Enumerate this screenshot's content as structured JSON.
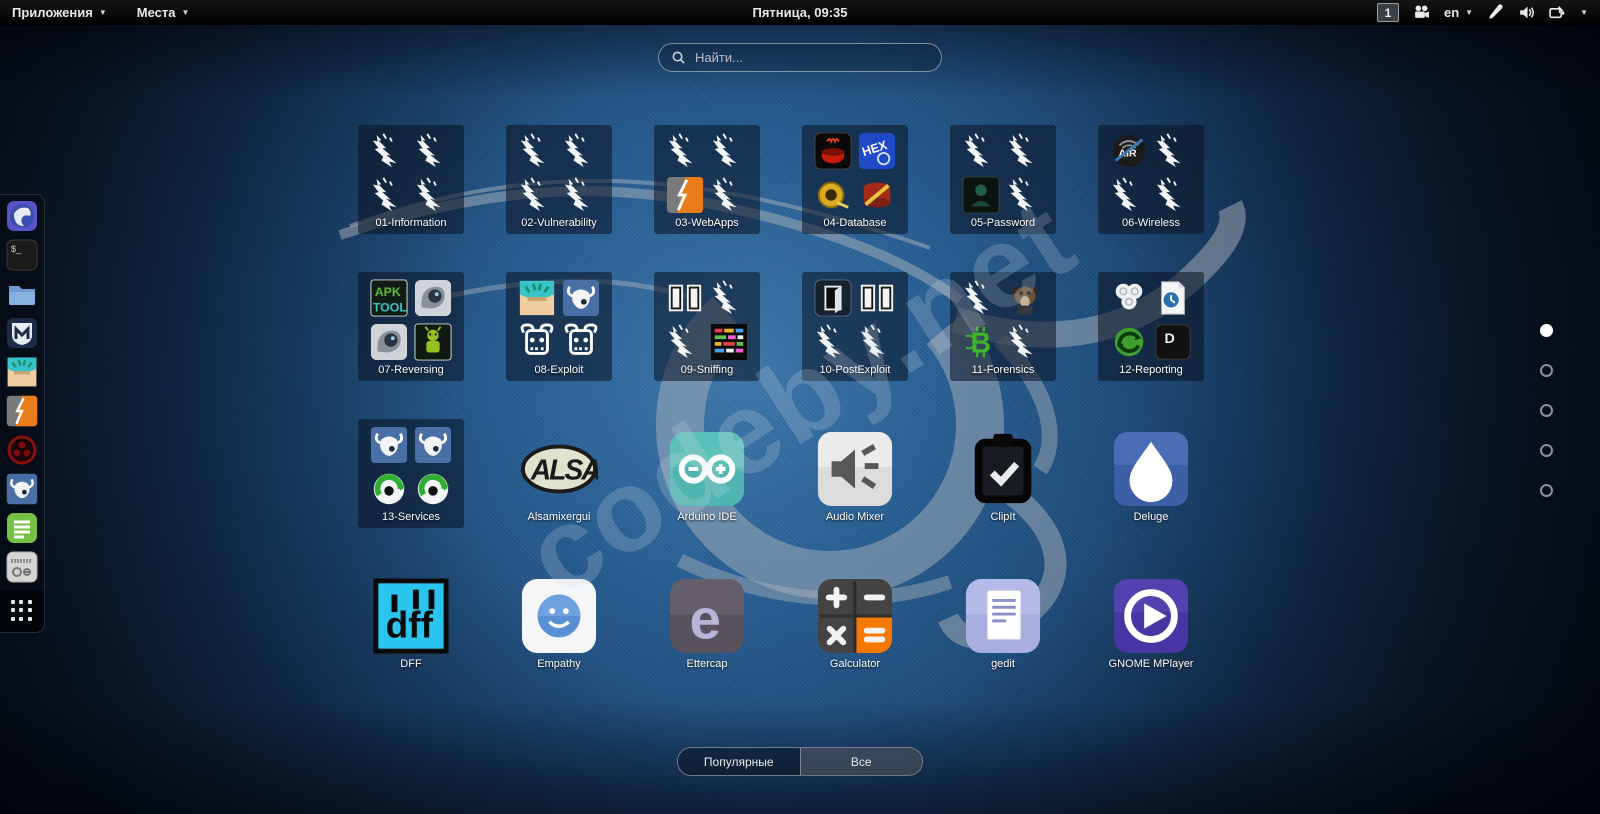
{
  "topbar": {
    "applications_menu": "Приложения",
    "places_menu": "Места",
    "clock": "Пятница, 09:35",
    "workspace_indicator": "1",
    "keyboard_layout": "en",
    "status_icons": [
      "video-camera-icon",
      "pen-icon",
      "volume-icon",
      "battery-icon"
    ]
  },
  "search": {
    "placeholder": "Найти..."
  },
  "dock": {
    "items": [
      {
        "name": "iceweasel-browser",
        "icon": "iceweasel"
      },
      {
        "name": "terminal",
        "icon": "terminal"
      },
      {
        "name": "files",
        "icon": "files"
      },
      {
        "name": "metasploit",
        "icon": "metasploit"
      },
      {
        "name": "armitage",
        "icon": "armitage"
      },
      {
        "name": "burpsuite",
        "icon": "burp"
      },
      {
        "name": "red-orb-app",
        "icon": "redorb"
      },
      {
        "name": "beef",
        "icon": "beefbull"
      },
      {
        "name": "leafpad",
        "icon": "leafpad"
      },
      {
        "name": "mixer-device",
        "icon": "mixer"
      }
    ],
    "show_apps": "show-applications"
  },
  "app_grid": {
    "folders": [
      {
        "label": "01-Information",
        "icons": [
          "dragon",
          "dragon",
          "dragon",
          "dragon"
        ]
      },
      {
        "label": "02-Vulnerability",
        "icons": [
          "dragon",
          "dragon",
          "dragon",
          "dragon"
        ]
      },
      {
        "label": "03-WebApps",
        "icons": [
          "dragon",
          "dragon",
          "burp",
          "dragon"
        ]
      },
      {
        "label": "04-Database",
        "icons": [
          "cauldron",
          "hex",
          "oracle",
          "sqlmap"
        ]
      },
      {
        "label": "05-Password",
        "icons": [
          "dragon",
          "dragon",
          "johnny",
          "dragon"
        ]
      },
      {
        "label": "06-Wireless",
        "icons": [
          "air",
          "dragon",
          "dragon",
          "dragon"
        ]
      },
      {
        "label": "07-Reversing",
        "icons": [
          "apktool",
          "robot",
          "robot",
          "android"
        ]
      },
      {
        "label": "08-Exploit",
        "icons": [
          "armitage",
          "beefbull",
          "bullskull",
          "bullskull"
        ]
      },
      {
        "label": "09-Sniffing",
        "icons": [
          "doors",
          "dragon",
          "dragon",
          "pixels"
        ]
      },
      {
        "label": "10-PostExploit",
        "icons": [
          "doordark",
          "doors",
          "dragon",
          "dragon"
        ]
      },
      {
        "label": "11-Forensics",
        "icons": [
          "dragon",
          "dog",
          "bitcoin",
          "dragon"
        ]
      },
      {
        "label": "12-Reporting",
        "icons": [
          "circles",
          "docclock",
          "greenswirl",
          "dkey"
        ]
      },
      {
        "label": "13-Services",
        "icons": [
          "beefbull",
          "beefbull",
          "greenorb",
          "greenorb"
        ]
      }
    ],
    "apps": [
      {
        "label": "Alsamixergui",
        "icon": "alsa"
      },
      {
        "label": "Arduino IDE",
        "icon": "arduino"
      },
      {
        "label": "Audio Mixer",
        "icon": "audiomixer"
      },
      {
        "label": "ClipIt",
        "icon": "clipit"
      },
      {
        "label": "Deluge",
        "icon": "deluge"
      },
      {
        "label": "DFF",
        "icon": "dff"
      },
      {
        "label": "Empathy",
        "icon": "empathy"
      },
      {
        "label": "Ettercap",
        "icon": "ettercap"
      },
      {
        "label": "Galculator",
        "icon": "galculator"
      },
      {
        "label": "gedit",
        "icon": "gedit"
      },
      {
        "label": "GNOME MPlayer",
        "icon": "mplayer"
      }
    ]
  },
  "pagination": {
    "pages": 5,
    "active_index": 0
  },
  "footer": {
    "popular_label": "Популярные",
    "all_label": "Все",
    "selected": "Все"
  },
  "watermark": "codeby.net",
  "colors": {
    "wallpaper_blue": "#2e6ca8",
    "topbar_black": "#000000",
    "accent_orange": "#e87d1a"
  }
}
